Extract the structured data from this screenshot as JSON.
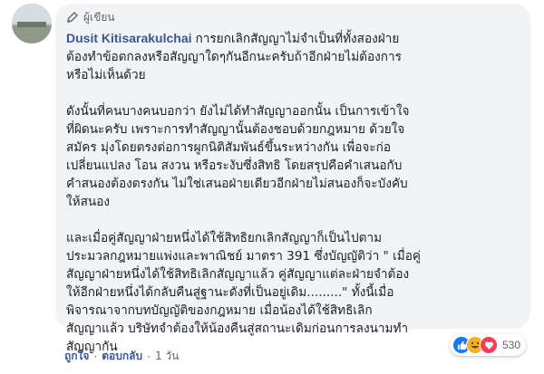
{
  "comment": {
    "badge": "ผู้เขียน",
    "author": "Dusit Kitisarakulchai",
    "paragraphs": [
      [
        "การยกเลิกสัญญาไม่จำเป็นที่ทั้งสองฝ่าย",
        "ต้องทำข้อตกลงหรือสัญญาใดๆกันอีกนะครับถ้าอีกฝ่ายไม่ต้องการ",
        "หรือไม่เห็นด้วย"
      ],
      [
        "ดังนั้นที่คนบางคนบอกว่า ยังไม่ได้ทำสัญญาออกนั้น เป็นการเข้าใจ",
        "ที่ผิดนะครับ เพราะการทำสัญญานั้นต้องชอบด้วยกฎหมาย ด้วยใจ",
        "สมัคร มุ่งโดยตรงต่อการผูกนิติสัมพันธ์ขึ้นระหว่างกัน เพื่อจะก่อ",
        "เปลี่ยนแปลง โอน สงวน หรือระงับซึ่งสิทธิ โดยสรุปคือคำเสนอกับ",
        "คำสนองต้องตรงกัน ไม่ใช่เสนอฝ่ายเดียวอีกฝ่ายไม่สนองก็จะบังคับ",
        "ให้สนอง"
      ],
      [
        "และเมื่อคู่สัญญาฝ่ายหนึ่งได้ใช้สิทธิยกเลิกสัญญาก็เป็นไปตาม",
        "ประมวลกฎหมายแพ่งและพาณิชย์ มาตรา 391 ซึ่งบัญญัติว่า \" เมื่อคู่",
        "สัญญาฝ่ายหนึ่งได้ใช้สิทธิเลิกสัญญาแล้ว คู่สัญญาแต่ละฝ่ายจำต้อง",
        "ให้อีกฝ่ายหนึ่งได้กลับคืนสู่ฐานะดังที่เป็นอยู่เดิม.........\" ทั้งนี้เมื่อ",
        "พิจารณาจากบทบัญญัติของกฎหมาย เมื่อน้องได้ใช้สิทธิเลิก",
        "สัญญาแล้ว บริษัทจำต้องให้น้องคืนสู่สถานะเดิมก่อนการลงนามทำ",
        "สัญญากัน"
      ]
    ],
    "reactions": {
      "icons": [
        "like-icon",
        "haha-icon",
        "love-icon"
      ],
      "count": "530",
      "colors": {
        "like": "#1877f2",
        "haha": "#f7b125",
        "love": "#f33e58"
      }
    },
    "actions": {
      "like": "ถูกใจ",
      "reply": "ตอบกลับ",
      "time": "1 วัน",
      "separator": "·"
    }
  }
}
